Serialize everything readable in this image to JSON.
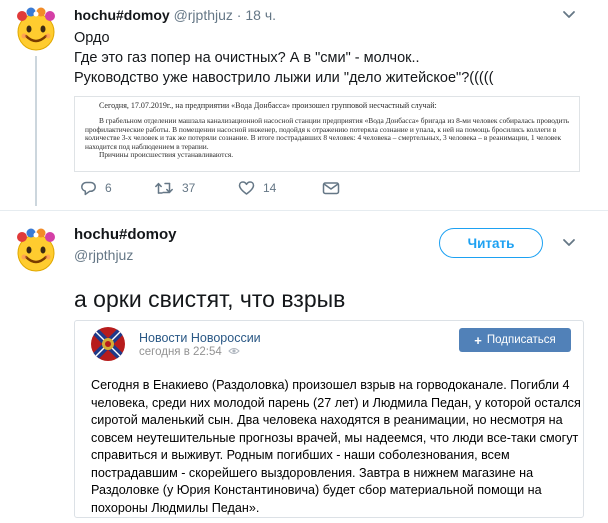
{
  "colors": {
    "accent": "#1da1f2",
    "muted": "#657786",
    "thread_line": "#ccd6dd",
    "vk_blue": "#5181b8",
    "vk_link": "#2a5885"
  },
  "tweet1": {
    "avatar_icon": "emoji-face-with-flower-crown-icon",
    "name": "hochu#domoy",
    "handle": "@rjpthjuz",
    "dot": "·",
    "time": "18 ч.",
    "text_lines": [
      "Ордо",
      "Где это газ попер на очистных? А в \"сми\" - молчок..",
      "Руководство уже навострило лыжи или \"дело житейское\"?((((("
    ],
    "image": {
      "line1": "Сегодня, 17.07.2019г., на предприятии «Вода Донбасса» произошел групповой несчастный случай:",
      "paragraph": "В грабельном отделении машзала канализационной насосной станции предприятия «Вода Донбасса» бригада из 8-ми человек собиралась проводить профилактические работы. В помещении насосной инженер, подойдя к отражению потеряла сознание и упала, к ней на помощь бросились коллеги в количестве 3-х человек и так же потеряли сознание. В итоге пострадавших 8 человек: 4 человека – смертельных, 3 человека – в реанимации, 1 человек находится под наблюдением в терапии.",
      "last": "Причины происшествия устанавливаются."
    },
    "actions": {
      "reply_count": "6",
      "retweet_count": "37",
      "like_count": "14"
    }
  },
  "tweet2": {
    "avatar_icon": "emoji-face-with-flower-crown-icon",
    "name": "hochu#domoy",
    "handle": "@rjpthjuz",
    "follow_label": "Читать",
    "text": "а орки свистят, что взрыв",
    "embed": {
      "group_name": "Новости Новороссии",
      "time": "сегодня в 22:54",
      "subscribe_label": "Подписаться",
      "body_lines": [
        "Сегодня в Енакиево (Раздоловка) произошел взрыв на горводоканале. Погибли 4",
        "человека, среди них молодой парень (27 лет) и Людмила Педан, у которой остался",
        "сиротой маленький сын. Два человека находятся в реанимации, но несмотря на",
        "совсем неутешительные прогнозы врачей, мы надеемся, что люди все-таки смогут",
        "справиться и выживут. Родным погибших - наши соболезнования, всем",
        "пострадавшим - скорейшего выздоровления. Завтра в нижнем магазине на",
        "Раздоловке (у Юрия Константиновича) будет сбор материальной помощи на",
        "похороны Людмилы Педан»."
      ]
    }
  }
}
